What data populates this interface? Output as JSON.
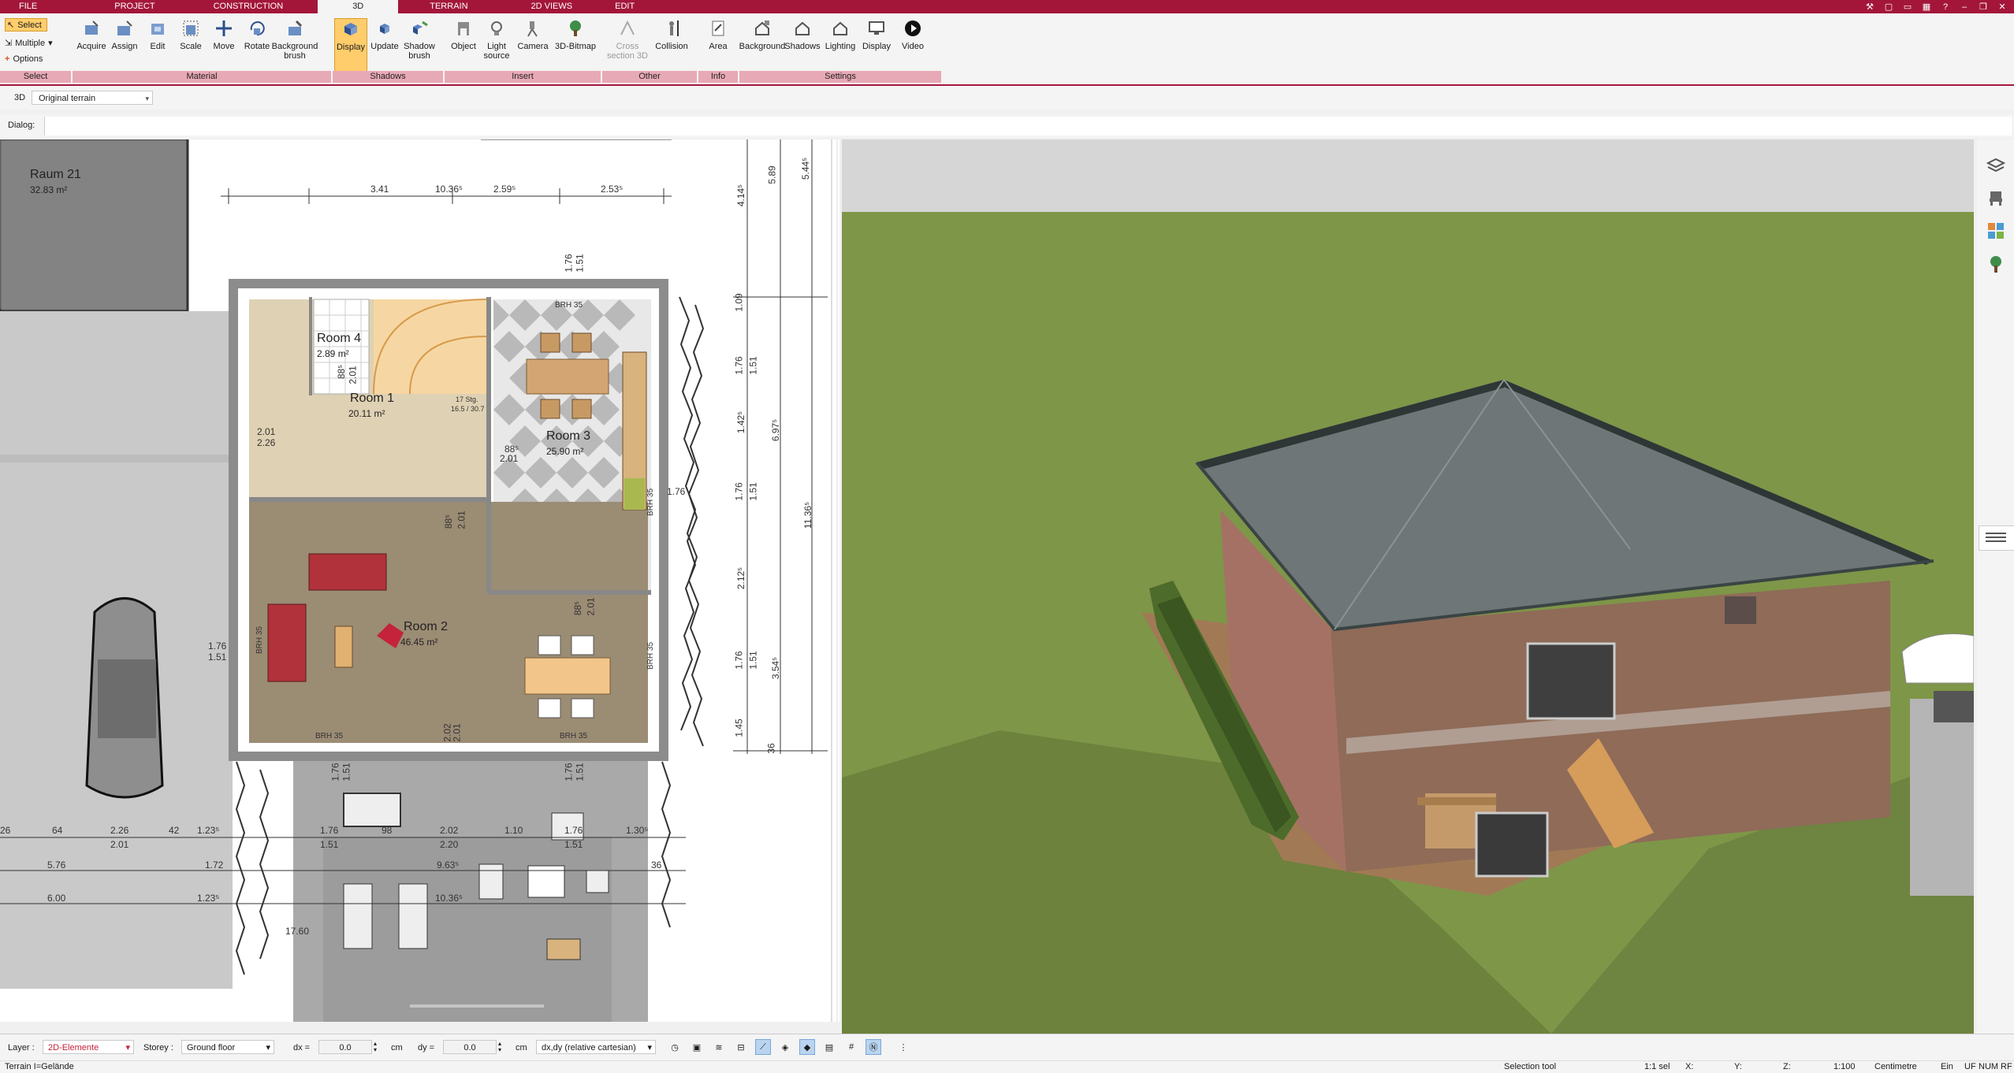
{
  "tabs": [
    "FILE",
    "PROJECT",
    "CONSTRUCTION",
    "3D",
    "TERRAIN",
    "2D VIEWS",
    "EDIT"
  ],
  "active_tab": "3D",
  "select_group": {
    "select_label": "Select",
    "multiple_label": "Multiple",
    "options_label": "Options",
    "title": "Select"
  },
  "material_group": {
    "title": "Material",
    "buttons": [
      "Acquire",
      "Assign",
      "Edit",
      "Scale",
      "Move",
      "Rotate",
      "Background brush"
    ]
  },
  "shadows_group": {
    "title": "Shadows",
    "buttons": [
      "Display",
      "Update",
      "Shadow brush"
    ]
  },
  "insert_group": {
    "title": "Insert",
    "buttons": [
      "Object",
      "Light source",
      "Camera",
      "3D-Bitmap"
    ]
  },
  "other_group": {
    "title": "Other",
    "buttons": [
      "Cross section 3D",
      "Collision"
    ]
  },
  "info_group": {
    "title": "Info",
    "buttons": [
      "Area"
    ]
  },
  "settings_group": {
    "title": "Settings",
    "buttons": [
      "Background",
      "Shadows",
      "Lighting",
      "Display",
      "Video"
    ]
  },
  "view_row": {
    "label": "3D",
    "terrain_value": "Original terrain"
  },
  "dialog_row": {
    "label": "Dialog:"
  },
  "plan": {
    "rooms": [
      {
        "name": "Raum 21",
        "area": "32.83 m²"
      },
      {
        "name": "Room 4",
        "area": "2.89 m²"
      },
      {
        "name": "Room 1",
        "area": "20.11 m²"
      },
      {
        "name": "Room 3",
        "area": "25.90 m²"
      },
      {
        "name": "Room 2",
        "area": "46.45 m²"
      }
    ],
    "top_dims": [
      "3.41",
      "10.36⁵",
      "2.59⁵",
      "2.53⁵"
    ],
    "right_dims": [
      "5.89",
      "5.44⁵",
      "4.14⁵",
      "1.09",
      "1.76",
      "1.51",
      "1.42⁵",
      "6.97⁵",
      "1.76",
      "1.51",
      "11.36⁵",
      "2.12⁵",
      "1.76",
      "1.51",
      "3.54⁵",
      "1.45",
      "36"
    ],
    "bottom_dims": [
      "26",
      "64",
      "2.26",
      "2.01",
      "42",
      "1.23⁵",
      "1.76",
      "1.51",
      "98",
      "2.02",
      "2.20",
      "1.10",
      "1.76",
      "1.51",
      "1.30⁵",
      "5.76",
      "1.72",
      "9.63⁵",
      "36",
      "6.00",
      "1.23⁵",
      "10.36⁵",
      "17.60"
    ],
    "misc_labels": [
      "BRH 35",
      "BRH 35",
      "BRH 35",
      "BRH 35",
      "BRH 35",
      "BRH 35",
      "17 Stg.",
      "16.5 / 30.7",
      "88⁵",
      "2.01",
      "2.01",
      "2.26",
      "88⁵",
      "2.01",
      "88⁵",
      "2.01",
      "88⁵",
      "2.01",
      "1.76",
      "1.51",
      "2.02",
      "2.01",
      "1.76",
      "1.51",
      "1.76",
      "1.51",
      "1.76",
      "1.51",
      "1.76"
    ]
  },
  "bottom_bar": {
    "layer_label": "Layer :",
    "layer_value": "2D-Elemente",
    "storey_label": "Storey :",
    "storey_value": "Ground floor",
    "dx_label": "dx =",
    "dx_value": "0.0",
    "dx_unit": "cm",
    "dy_label": "dy =",
    "dy_value": "0.0",
    "dy_unit": "cm",
    "mode_value": "dx,dy (relative cartesian)"
  },
  "status_bar": {
    "terrain": "Terrain I=Gelände",
    "tool": "Selection tool",
    "sel": "1:1 sel",
    "x": "X:",
    "y": "Y:",
    "z": "Z:",
    "scale": "1:100",
    "unit": "Centimetre",
    "ein": "Ein",
    "uf": "UF",
    "num": "NUM",
    "rf": "RF"
  },
  "colors": {
    "brand": "#a3163a",
    "ribbon_group_title": "#e8a9b6",
    "active_button": "#ffcd6b",
    "grass": "#7e9648"
  }
}
